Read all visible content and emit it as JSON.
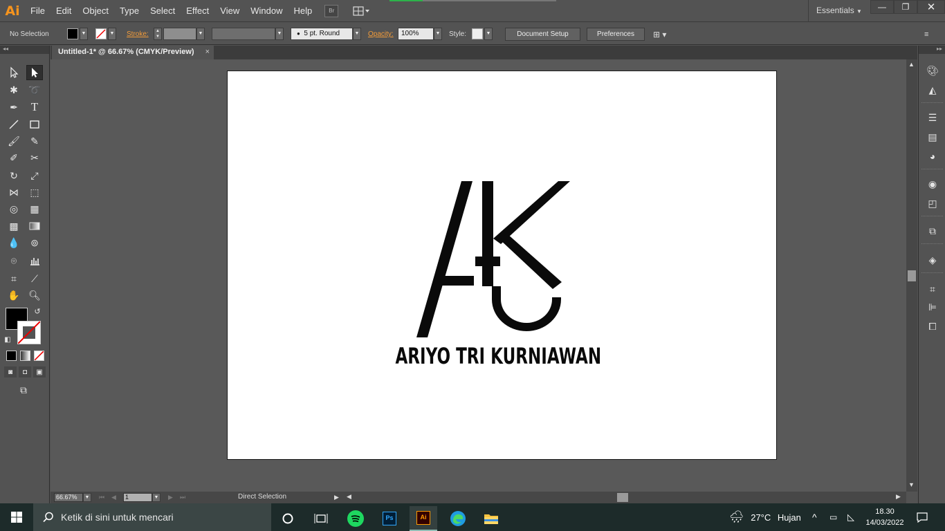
{
  "app": {
    "logo": "Ai",
    "name": "Adobe Illustrator"
  },
  "menu": [
    "File",
    "Edit",
    "Object",
    "Type",
    "Select",
    "Effect",
    "View",
    "Window",
    "Help"
  ],
  "bridge_label": "Br",
  "workspace": "Essentials",
  "control": {
    "selection": "No Selection",
    "stroke_label": "Stroke:",
    "brush": "5 pt. Round",
    "opacity_label": "Opacity:",
    "opacity_value": "100%",
    "style_label": "Style:",
    "document_setup": "Document Setup",
    "preferences": "Preferences"
  },
  "document": {
    "tab_title": "Untitled-1* @ 66.67% (CMYK/Preview)",
    "artwork_text": "ARIYO TRI KURNIAWAN"
  },
  "status": {
    "zoom": "66.67%",
    "page": "1",
    "tool": "Direct Selection"
  },
  "taskbar": {
    "search_placeholder": "Ketik di sini untuk mencari",
    "weather_temp": "27°C",
    "weather_text": "Hujan",
    "time": "18.30",
    "date": "14/03/2022",
    "apps": [
      "cortana",
      "task-view",
      "spotify",
      "photoshop",
      "illustrator",
      "edge",
      "file-explorer"
    ]
  },
  "colors": {
    "ui_bg": "#535353",
    "accent_orange": "#f7941d",
    "taskbar": "#1d2b2a",
    "artwork": "#0a0a0a"
  }
}
